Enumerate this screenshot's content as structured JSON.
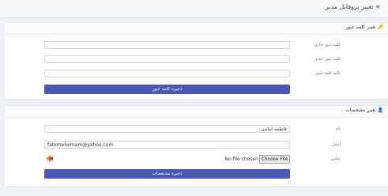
{
  "header": {
    "title": "تغییر پروفایل مدیر",
    "icon": "double-chevron-icon"
  },
  "password_panel": {
    "title": "تغییر کلمه عبور",
    "icon": "key-icon",
    "fields": {
      "current_label": "کلمه عبور جاری",
      "new_label": "کلمه عبور جدید",
      "confirm_label": "تاکید کلمه عبور"
    },
    "submit_label": "ذخیره کلمه عبور"
  },
  "profile_panel": {
    "title": "تغییر مشخصات",
    "icon": "user-icon",
    "fields": {
      "name_label": "نام",
      "name_value": "فاطمه امامی",
      "email_label": "ایمیل",
      "email_value": "fatemehemam@yahoo.com",
      "image_label": "عکس",
      "file_status": "No file chosen",
      "file_button": "Choose File"
    },
    "submit_label": "ذخیره مشخصات"
  },
  "colors": {
    "button": "#4b57b4",
    "background": "#eef1f5"
  }
}
